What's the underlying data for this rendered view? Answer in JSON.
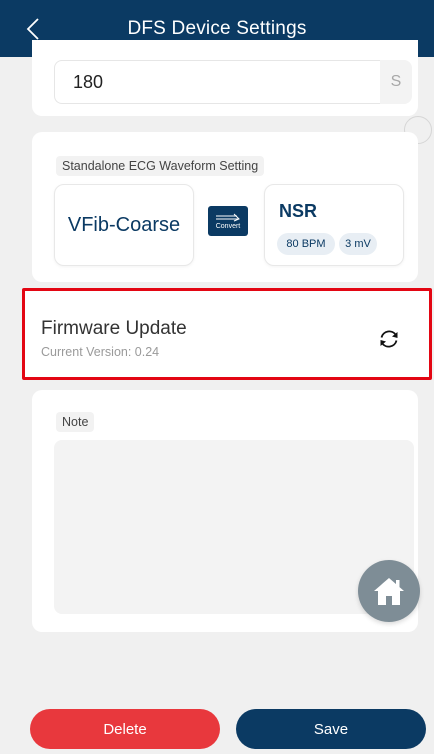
{
  "header": {
    "title": "DFS Device Settings",
    "back_icon": "chevron-left-icon",
    "background": "#0b3a63"
  },
  "time_setting": {
    "value": "180",
    "unit": "S"
  },
  "ecg_setting": {
    "label": "Standalone ECG Waveform Setting",
    "current_waveform": "VFib-Coarse",
    "convert_label": "Convert",
    "target_waveform": {
      "name": "NSR",
      "rate": "80 BPM",
      "amplitude": "3 mV"
    }
  },
  "firmware": {
    "title": "Firmware Update",
    "version_text": "Current Version: 0.24",
    "refresh_icon": "refresh-icon",
    "highlight_color": "#e30613"
  },
  "note": {
    "label": "Note",
    "value": ""
  },
  "floating": {
    "home_icon": "home-icon"
  },
  "actions": {
    "delete_label": "Delete",
    "save_label": "Save",
    "delete_color": "#e8383d",
    "save_color": "#0b3a63"
  }
}
